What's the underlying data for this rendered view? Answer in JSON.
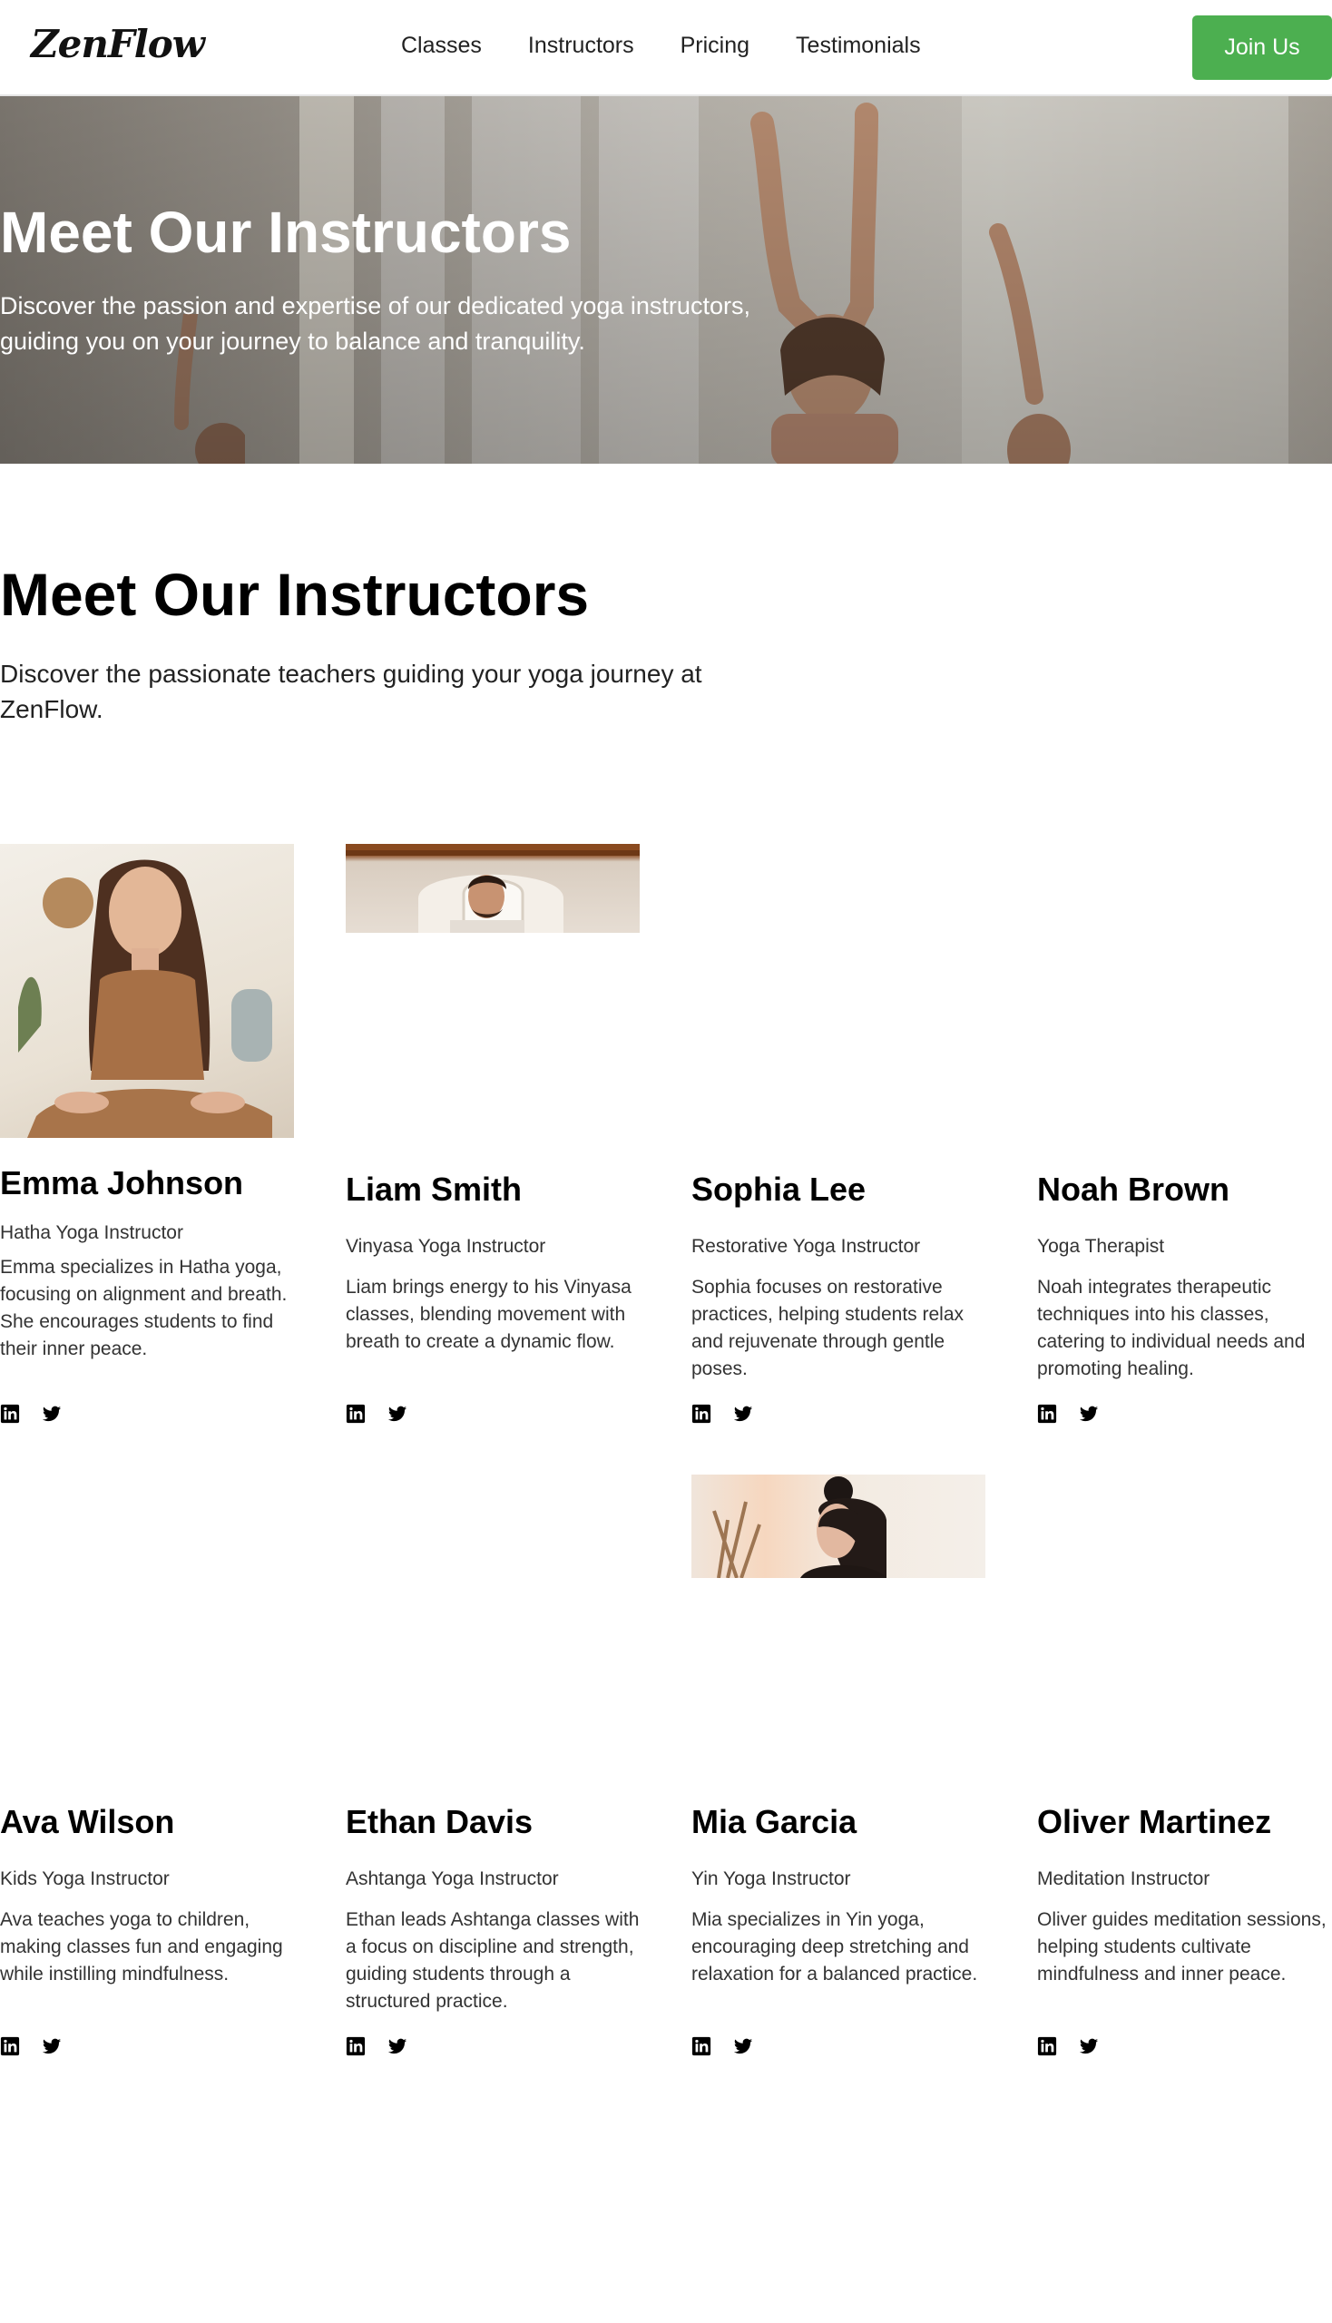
{
  "brand": {
    "logo": "ZenFlow"
  },
  "nav": {
    "links": [
      "Classes",
      "Instructors",
      "Pricing",
      "Testimonials"
    ],
    "cta": "Join Us",
    "accent": "#4caf50"
  },
  "hero": {
    "title": "Meet Our Instructors",
    "subtitle": "Discover the passion and expertise of our dedicated yoga instructors, guiding you on your journey to balance and tranquility."
  },
  "section": {
    "title": "Meet Our Instructors",
    "subtitle": "Discover the passionate teachers guiding your yoga journey at ZenFlow."
  },
  "instructors": [
    {
      "name": "Emma Johnson",
      "role": "Hatha Yoga Instructor",
      "bio": "Emma specializes in Hatha yoga, focusing on alignment and breath. She encourages students to find their inner peace.",
      "photo": "woman-meditating",
      "social": [
        "linkedin-icon",
        "twitter-icon"
      ]
    },
    {
      "name": "Liam Smith",
      "role": "Vinyasa Yoga Instructor",
      "bio": "Liam brings energy to his Vinyasa classes, blending movement with breath to create a dynamic flow.",
      "photo": "smiling-man",
      "social": [
        "linkedin-icon",
        "twitter-icon"
      ]
    },
    {
      "name": "Sophia Lee",
      "role": "Restorative Yoga Instructor",
      "bio": "Sophia focuses on restorative practices, helping students relax and rejuvenate through gentle poses.",
      "photo": "",
      "social": [
        "linkedin-icon",
        "twitter-icon"
      ]
    },
    {
      "name": "Noah Brown",
      "role": "Yoga Therapist",
      "bio": "Noah integrates therapeutic techniques into his classes, catering to individual needs and promoting healing.",
      "photo": "",
      "social": [
        "linkedin-icon",
        "twitter-icon"
      ]
    },
    {
      "name": "Ava Wilson",
      "role": "Kids Yoga Instructor",
      "bio": "Ava teaches yoga to children, making classes fun and engaging while instilling mindfulness.",
      "photo": "",
      "social": [
        "linkedin-icon",
        "twitter-icon"
      ]
    },
    {
      "name": "Ethan Davis",
      "role": "Ashtanga Yoga Instructor",
      "bio": "Ethan leads Ashtanga classes with a focus on discipline and strength, guiding students through a structured practice.",
      "photo": "",
      "social": [
        "linkedin-icon",
        "twitter-icon"
      ]
    },
    {
      "name": "Mia Garcia",
      "role": "Yin Yoga Instructor",
      "bio": "Mia specializes in Yin yoga, encouraging deep stretching and relaxation for a balanced practice.",
      "photo": "woman-with-bun",
      "social": [
        "linkedin-icon",
        "twitter-icon"
      ]
    },
    {
      "name": "Oliver Martinez",
      "role": "Meditation Instructor",
      "bio": "Oliver guides meditation sessions, helping students cultivate mindfulness and inner peace.",
      "photo": "",
      "social": [
        "linkedin-icon",
        "twitter-icon"
      ]
    }
  ]
}
